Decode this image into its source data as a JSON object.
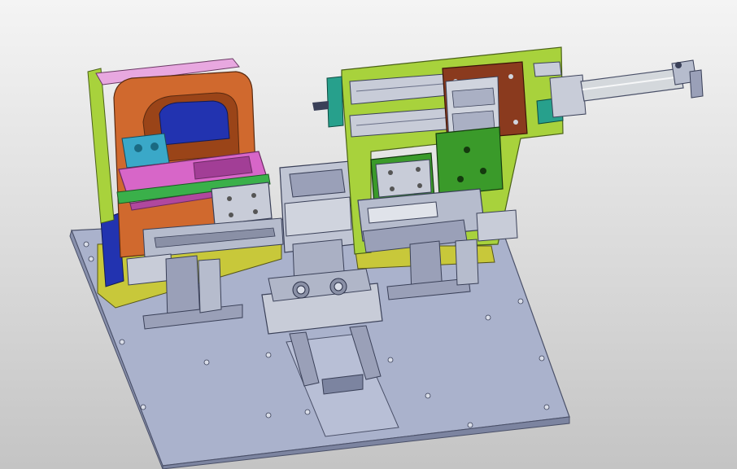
{
  "viewport": {
    "background_top": "#f4f4f4",
    "background_bottom": "#c4c4c4"
  },
  "model": {
    "subject": "cad-assembly-fixture",
    "colors": {
      "base_plate": "#aab2cc",
      "steel": "#c8ccd8",
      "orange_bracket": "#d0692e",
      "pink_plate": "#d766c8",
      "green_frame": "#a8d23c",
      "dark_green_block": "#3a9a2a",
      "brown_plate": "#8a3a1e",
      "teal_block": "#27a08c",
      "blue_part": "#2233b0",
      "cyan_clamp": "#3aa8c8",
      "yellow_base": "#c8c83a",
      "cylinder": "#d4d8dc"
    }
  }
}
